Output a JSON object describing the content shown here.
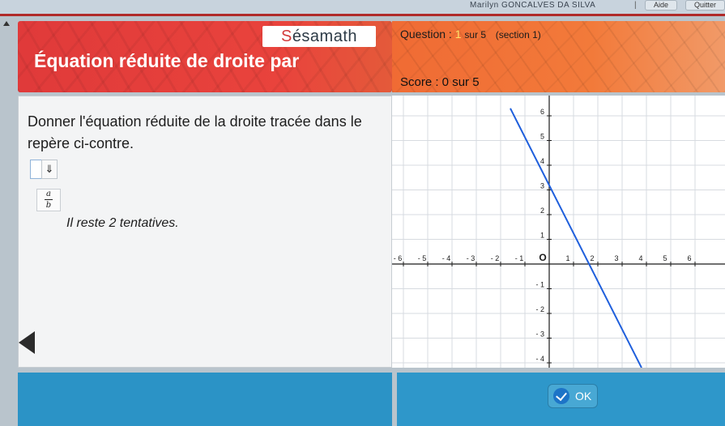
{
  "topbar": {
    "user": "Marilyn GONCALVES DA SILVA",
    "separator": "|",
    "help_label": "Aide",
    "quit_label": "Quitter"
  },
  "header": {
    "logo_prefix": "S",
    "logo_rest": "ésamath",
    "title": "Équation réduite de droite par"
  },
  "question": {
    "label": "Question :",
    "current": "1",
    "total_text": "sur 5",
    "section": "(section 1)",
    "score": "Score : 0 sur 5"
  },
  "content": {
    "instruction": "Donner l'équation réduite de la droite tracée dans le repère ci-contre.",
    "answer_button_symbol": "⇓",
    "fraction_numerator": "a",
    "fraction_denominator": "b",
    "tries_text": "Il reste 2 tentatives."
  },
  "footer": {
    "ok_label": "OK"
  },
  "colors": {
    "title_red": "#e03a3a",
    "question_orange": "#f06b34",
    "line_blue": "#1f5fdc",
    "footer_blue": "#2b93c6"
  },
  "chart_data": {
    "type": "line",
    "x_ticks": [
      "- 6",
      "- 5",
      "- 4",
      "- 3",
      "- 2",
      "- 1",
      "O",
      "1",
      "2",
      "3",
      "4",
      "5",
      "6"
    ],
    "y_ticks_positive": [
      "1",
      "2",
      "3",
      "4",
      "5",
      "6"
    ],
    "y_ticks_negative": [
      "- 1",
      "- 2",
      "- 3",
      "- 4"
    ],
    "xlim": [
      -6.5,
      6.5
    ],
    "ylim": [
      -4.2,
      6.3
    ],
    "grid": true,
    "series": [
      {
        "x": [
          -1.6,
          3.8
        ],
        "y": [
          6.3,
          -4.2
        ]
      }
    ]
  }
}
